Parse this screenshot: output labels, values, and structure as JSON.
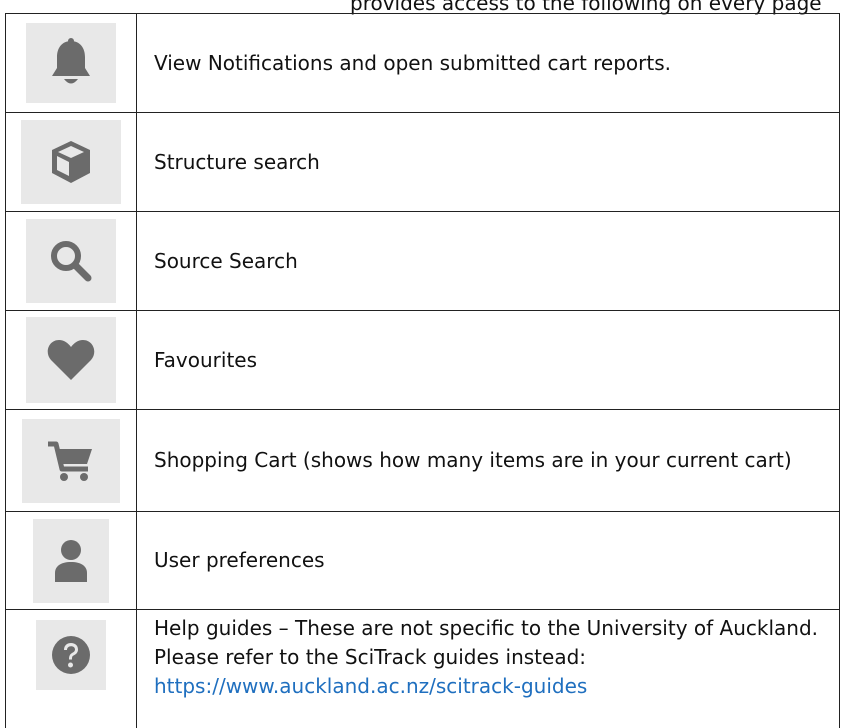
{
  "header": {
    "partial_line": "provides access to the following on every page"
  },
  "rows": [
    {
      "icon": "bell-icon",
      "text": "View Notifications and open submitted cart reports."
    },
    {
      "icon": "cube-icon",
      "text": "Structure search"
    },
    {
      "icon": "search-icon",
      "text": "Source Search"
    },
    {
      "icon": "heart-icon",
      "text": "Favourites"
    },
    {
      "icon": "cart-icon",
      "text": "Shopping Cart (shows how many items are in your current cart)"
    },
    {
      "icon": "user-icon",
      "text": "User preferences"
    },
    {
      "icon": "help-icon",
      "text": "Help guides – These are not specific to the University of Auckland. Please refer to the SciTrack guides instead:",
      "link": "https://www.auckland.ac.nz/scitrack-guides"
    }
  ],
  "colors": {
    "icon_gray": "#6b6b6b",
    "tile_bg": "#e8e8e8",
    "link": "#1f6fbf",
    "border": "#222222"
  }
}
